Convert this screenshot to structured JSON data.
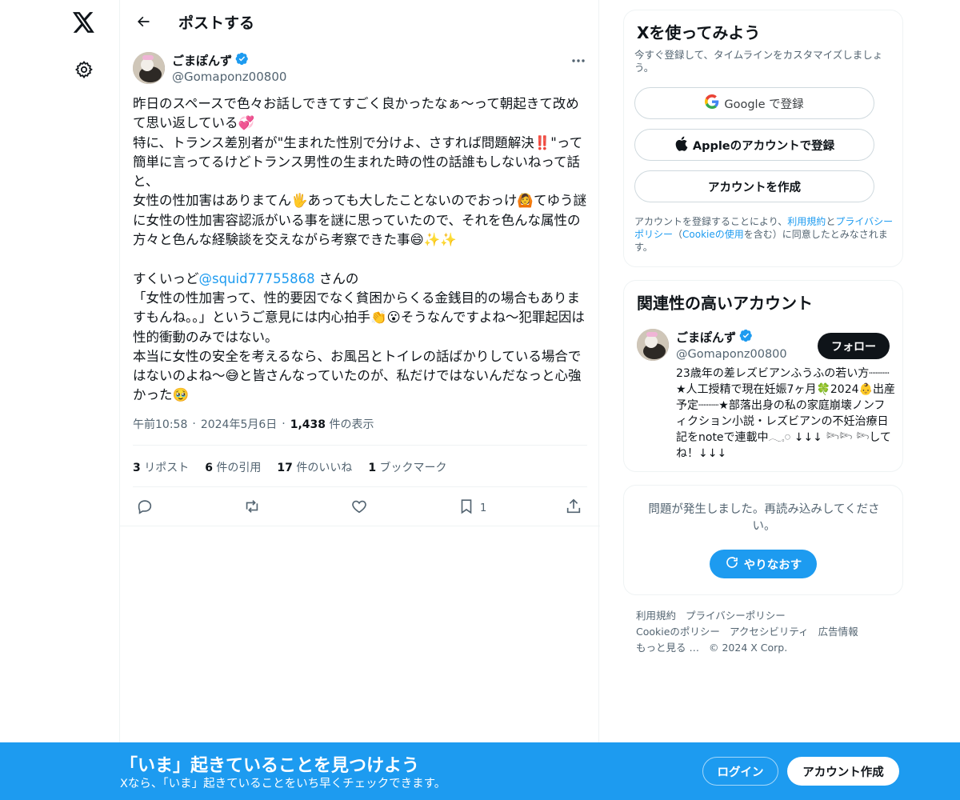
{
  "header": {
    "title": "ポストする"
  },
  "tweet": {
    "author_name": "ごまぽんず",
    "author_handle": "@Gomaponz00800",
    "text_part1": "昨日のスペースで色々お話しできてすごく良かったなぁ〜って朝起きて改めて思い返している💞\n特に、トランス差別者が\"生まれた性別で分けよ、さすれば問題解決‼️\"って簡単に言ってるけどトランス男性の生まれた時の性の話誰もしないねって話と、\n女性の性加害はありまてん🖐あっても大したことないのでおっけ🙆てゆう謎に女性の性加害容認派がいる事を謎に思っていたので、それを色んな属性の方々と色んな経験談を交えながら考察できた事😄✨✨\n\nすくいっど",
    "mention": "@squid77755868",
    "text_part2": " さんの\n「女性の性加害って、性的要因でなく貧困からくる金銭目的の場合もありますもんね。。」というご意見には内心拍手👏😮そうなんですよね〜犯罪起因は性的衝動のみではない。\n本当に女性の安全を考えるなら、お風呂とトイレの話ばかりしている場合ではないのよね〜😅と皆さんなっていたのが、私だけではないんだなっと心強かった🥹",
    "time": "午前10:58",
    "date": "2024年5月6日",
    "views_count": "1,438",
    "views_label": "件の表示",
    "stats": [
      {
        "count": "3",
        "label": "リポスト"
      },
      {
        "count": "6",
        "label": "件の引用"
      },
      {
        "count": "17",
        "label": "件のいいね"
      },
      {
        "count": "1",
        "label": "ブックマーク"
      }
    ],
    "bookmark_count": "1"
  },
  "signup": {
    "title": "Xを使ってみよう",
    "subtitle": "今すぐ登録して、タイムラインをカスタマイズしましょう。",
    "google_label": "Google で登録",
    "apple_label": "Appleのアカウントで登録",
    "create_label": "アカウントを作成",
    "terms_pre": "アカウントを登録することにより、",
    "terms_link1": "利用規約",
    "terms_mid1": "と",
    "terms_link2": "プライバシーポリシー",
    "terms_mid2": "（",
    "terms_link3": "Cookieの使用",
    "terms_post": "を含む）に同意したとみなされます。"
  },
  "related": {
    "title": "関連性の高いアカウント",
    "name": "ごまぽんず",
    "handle": "@Gomaponz00800",
    "follow_label": "フォロー",
    "bio": "23歳年の差レズビアンふうふの若い方┈┈┈★人工授精で現在妊娠7ヶ月🍀2024👶出産予定┈┈┈★部落出身の私の家庭崩壊ノンフィクション小説・レズビアンの不妊治療日記をnoteで連載中𓂃𓈒𓏸︎︎︎︎ ↓↓↓ 𓆸𓆸 𓆸してね！↓↓↓"
  },
  "error": {
    "message": "問題が発生しました。再読み込みしてください。",
    "retry_label": "やりなおす"
  },
  "footer": {
    "links": [
      "利用規約",
      "プライバシーポリシー",
      "Cookieのポリシー",
      "アクセシビリティ",
      "広告情報",
      "もっと見る …",
      "© 2024 X Corp."
    ]
  },
  "bottombar": {
    "title": "「いま」起きていることを見つけよう",
    "subtitle": "Xなら、「いま」起きていることをいち早くチェックできます。",
    "login_label": "ログイン",
    "signup_label": "アカウント作成"
  },
  "colors": {
    "accent": "#1d9bf0",
    "text": "#0f1419",
    "muted": "#536471",
    "verified": "#1d9bf0"
  }
}
